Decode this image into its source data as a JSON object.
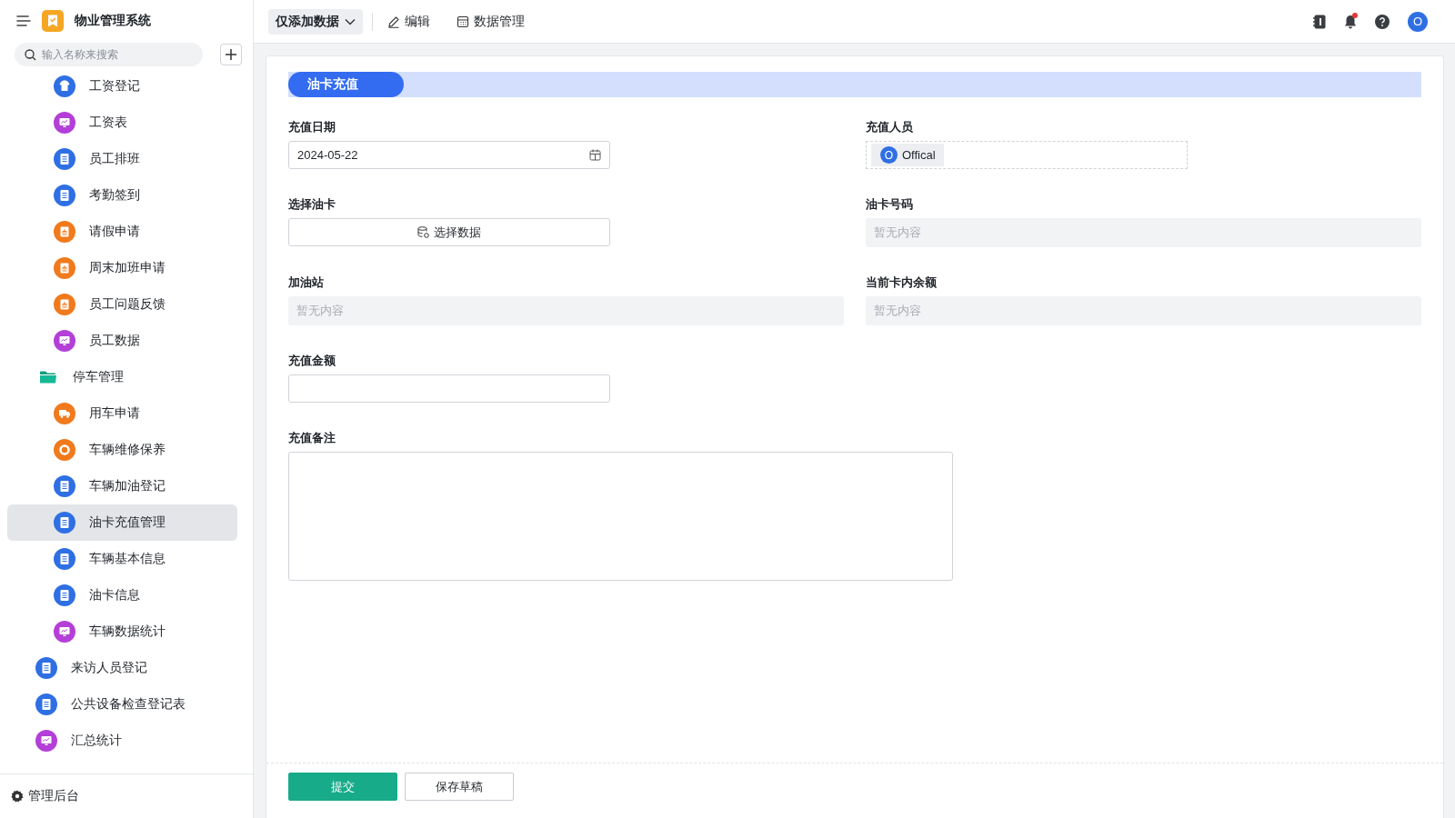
{
  "app": {
    "title": "物业管理系统"
  },
  "toolbar": {
    "mode_menu": "仅添加数据",
    "actions": [
      {
        "label": "编辑",
        "kind": "edit"
      },
      {
        "label": "数据管理",
        "kind": "table"
      }
    ],
    "notifications_unread": true,
    "avatar": "O"
  },
  "sidebar": {
    "search": {
      "placeholder": "输入名称来搜索"
    },
    "items": [
      {
        "children": [
          {
            "label": "工资登记",
            "kind": "shirt",
            "selected": false
          },
          {
            "label": "工资表",
            "kind": "chart",
            "selected": false
          },
          {
            "label": "员工排班",
            "kind": "doc",
            "selected": false
          },
          {
            "label": "考勤签到",
            "kind": "doc",
            "selected": false
          },
          {
            "label": "请假申请",
            "kind": "form",
            "selected": false
          },
          {
            "label": "周末加班申请",
            "kind": "form",
            "selected": false
          },
          {
            "label": "员工问题反馈",
            "kind": "form",
            "selected": false
          },
          {
            "label": "员工数据",
            "kind": "chart",
            "selected": false
          }
        ]
      },
      {
        "label": "停车管理",
        "kind": "folder",
        "selected": false,
        "children": [
          {
            "label": "用车申请",
            "kind": "truck",
            "selected": false
          },
          {
            "label": "车辆维修保养",
            "kind": "ring",
            "selected": false
          },
          {
            "label": "车辆加油登记",
            "kind": "doc",
            "selected": false
          },
          {
            "label": "油卡充值管理",
            "kind": "doc",
            "selected": true
          },
          {
            "label": "车辆基本信息",
            "kind": "doc",
            "selected": false
          },
          {
            "label": "油卡信息",
            "kind": "doc",
            "selected": false
          },
          {
            "label": "车辆数据统计",
            "kind": "chart",
            "selected": false
          }
        ]
      },
      {
        "label": "来访人员登记",
        "kind": "doc",
        "selected": false
      },
      {
        "label": "公共设备检查登记表",
        "kind": "doc",
        "selected": false
      },
      {
        "label": "汇总统计",
        "kind": "chart",
        "selected": false
      }
    ],
    "footer": "管理后台"
  },
  "form": {
    "section": "油卡充值",
    "fields": [
      {
        "label": "充值日期",
        "kind": "date",
        "value": "2024-05-22"
      },
      {
        "label": "充值人员",
        "kind": "user",
        "avatar": "O",
        "value": "Offical"
      },
      {
        "label": "选择油卡",
        "kind": "picker",
        "button": "选择数据"
      },
      {
        "label": "油卡号码",
        "kind": "readonly",
        "placeholder": "暂无内容"
      },
      {
        "label": "加油站",
        "kind": "readonly",
        "placeholder": "暂无内容"
      },
      {
        "label": "当前卡内余额",
        "kind": "readonly",
        "placeholder": "暂无内容"
      },
      {
        "label": "充值金额",
        "kind": "input"
      },
      {
        "label": "充值备注",
        "kind": "textarea"
      }
    ],
    "buttons": [
      {
        "label": "提交",
        "kind": "primary"
      },
      {
        "label": "保存草稿",
        "kind": "secondary"
      }
    ]
  }
}
